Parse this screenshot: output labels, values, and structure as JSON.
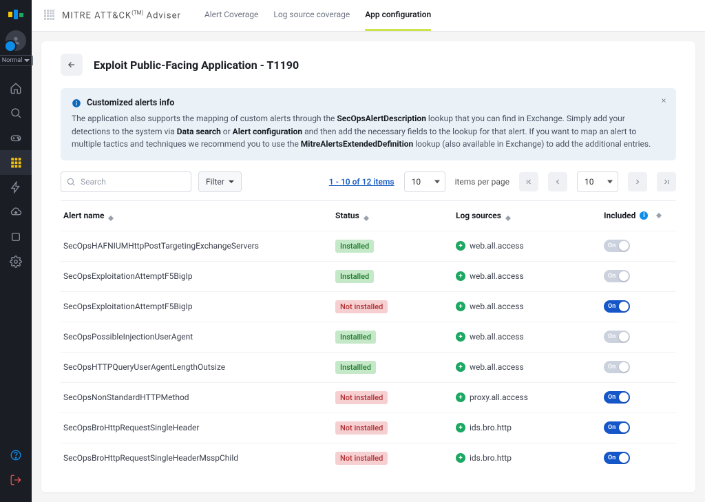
{
  "brand": {
    "name": "MITRE ATT&CK",
    "tm": "(TM)",
    "suffix": " Adviser"
  },
  "tabs": [
    {
      "label": "Alert Coverage"
    },
    {
      "label": "Log source coverage"
    },
    {
      "label": "App configuration"
    }
  ],
  "active_tab": 2,
  "sidebar_chip": "Normal",
  "page": {
    "title": "Exploit Public-Facing Application - T1190"
  },
  "banner": {
    "title": "Customized alerts info",
    "p1": "The application also supports the mapping of custom alerts through the ",
    "b1": "SecOpsAlertDescription",
    "p2": " lookup that you can find in Exchange. Simply add your detections to the system via ",
    "b2": "Data search",
    "p3": " or ",
    "b3": "Alert configuration",
    "p4": " and then add the necessary fields to the lookup for that alert. If you want to map an alert to multiple tactics and techniques we recommend you to use the ",
    "b4": "MitreAlertsExtendedDefinition",
    "p5": " lookup (also available in Exchange) to add the additional entries."
  },
  "toolbar": {
    "search_placeholder": "Search",
    "filter_label": "Filter",
    "range": "1 - 10 of 12 items",
    "page_size": "10",
    "page_size_label": "items per page",
    "page_current": "10"
  },
  "columns": {
    "name": "Alert name",
    "status": "Status",
    "log": "Log sources",
    "included": "Included"
  },
  "status_labels": {
    "installed": "Installed",
    "installled": "Installled",
    "not_installed": "Not installed"
  },
  "toggle_on_label": "On",
  "rows": [
    {
      "name": "SecOpsHAFNIUMHttpPostTargetingExchangeServers",
      "status": "installed",
      "log": "web.all.access",
      "on": false
    },
    {
      "name": "SecOpsExploitationAttemptF5BigIp",
      "status": "installed",
      "log": "web.all.access",
      "on": false
    },
    {
      "name": "SecOpsExploitationAttemptF5BigIp",
      "status": "not_installed",
      "log": "web.all.access",
      "on": true
    },
    {
      "name": "SecOpsPossibleInjectionUserAgent",
      "status": "installled",
      "log": "web.all.access",
      "on": false
    },
    {
      "name": "SecOpsHTTPQueryUserAgentLengthOutsize",
      "status": "installled",
      "log": "web.all.access",
      "on": false
    },
    {
      "name": "SecOpsNonStandardHTTPMethod",
      "status": "not_installed",
      "log": "proxy.all.access",
      "on": true
    },
    {
      "name": "SecOpsBroHttpRequestSingleHeader",
      "status": "not_installed",
      "log": "ids.bro.http",
      "on": true
    },
    {
      "name": "SecOpsBroHttpRequestSingleHeaderMsspChild",
      "status": "not_installed",
      "log": "ids.bro.http",
      "on": true
    }
  ]
}
